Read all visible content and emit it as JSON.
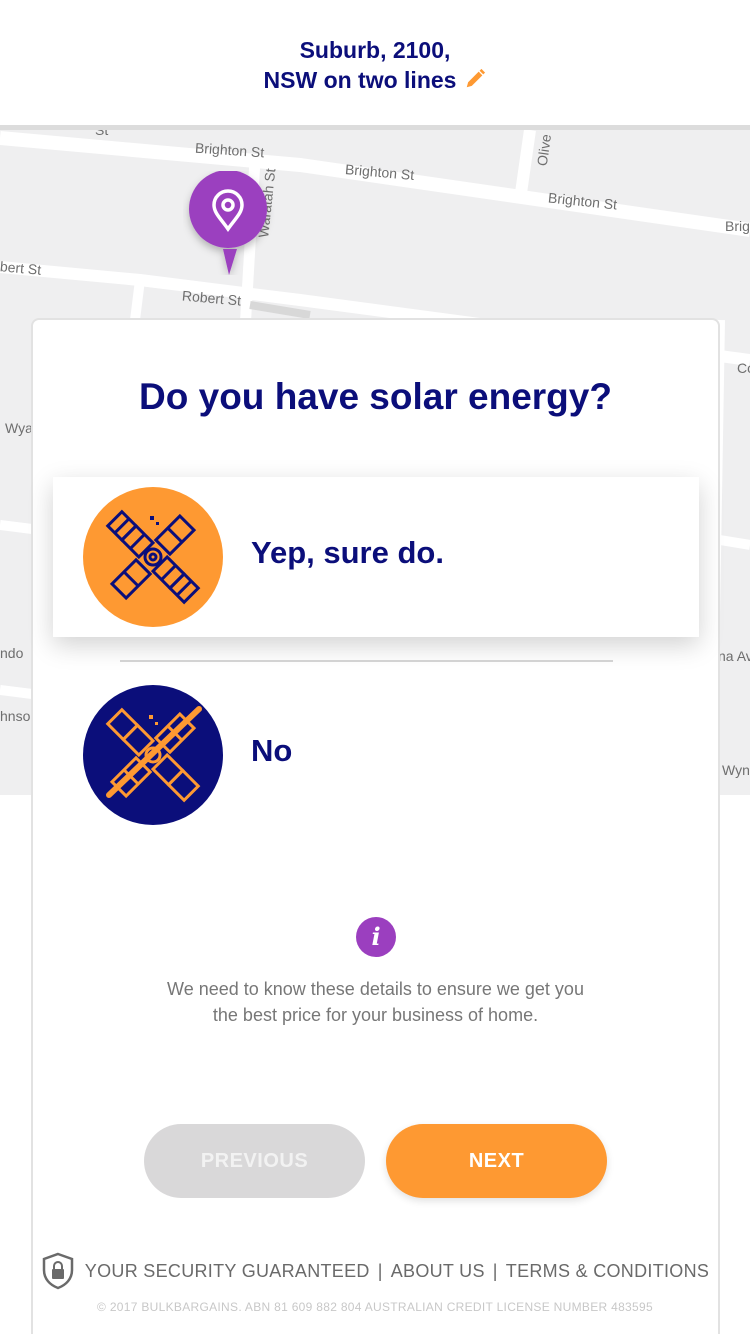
{
  "header": {
    "line1": "Suburb, 2100,",
    "line2": "NSW on two lines",
    "edit_icon": "pencil-icon",
    "accent_color": "#fe9932"
  },
  "map": {
    "labels": {
      "brighton_1": "Brighton St",
      "brighton_2": "Brighton St",
      "brighton_3": "Brighton St",
      "brighton_4": "Brig",
      "robert_1": "Robert St",
      "robert_2": "bert St",
      "waratah": "Waratah St",
      "olive": "Olive",
      "top_st": "St",
      "wya": "Wya",
      "wyndo": "ndo",
      "johnso": "hnso",
      "na_av": "na Av",
      "wynd": "Wynd",
      "co": "Co"
    },
    "pin_icon": "location-pin-icon",
    "pin_color": "#9b3fbf"
  },
  "card": {
    "question": "Do you have solar energy?",
    "options": [
      {
        "label": "Yep, sure do.",
        "selected": true,
        "icon": "solar-panel-icon",
        "circle_color": "#fe9932"
      },
      {
        "label": "No",
        "selected": false,
        "icon": "solar-panel-crossed-icon",
        "circle_color": "#0b0e7a"
      }
    ],
    "info_glyph": "i",
    "info_text_line1": "We need to know these details to ensure we get you",
    "info_text_line2": "the best price for your business of home.",
    "previous_label": "PREVIOUS",
    "next_label": "NEXT"
  },
  "footer": {
    "security": "YOUR SECURITY GUARANTEED",
    "separator": "|",
    "about": "ABOUT US",
    "terms": "TERMS & CONDITIONS",
    "copyright": "© 2017 BULKBARGAINS. ABN 81 609 882 804 AUSTRALIAN CREDIT LICENSE NUMBER 483595",
    "shield_icon": "lock-shield-icon"
  },
  "colors": {
    "navy": "#0b0e7a",
    "orange": "#fe9932",
    "purple": "#9b3fbf",
    "grey_button": "#d9d8d9"
  }
}
